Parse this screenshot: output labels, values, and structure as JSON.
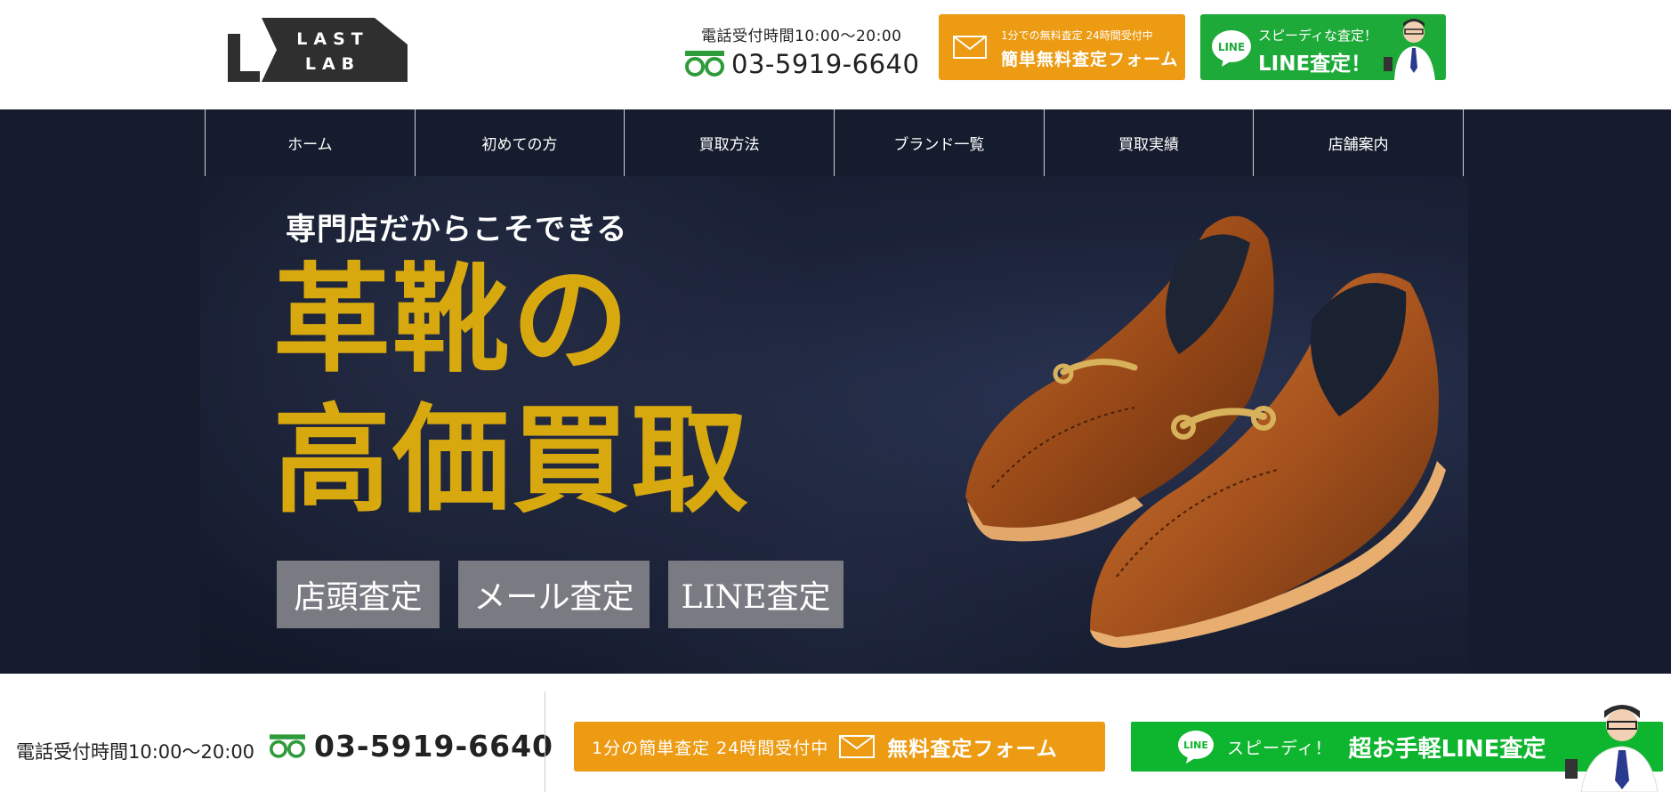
{
  "header": {
    "logo": {
      "line1": "LAST",
      "line2": "LAB",
      "alt": "L LAST LAB"
    },
    "tel": {
      "hours": "電話受付時間10:00〜20:00",
      "number": "03-5919-6640",
      "icon": "free-dial-icon"
    },
    "mail_button": {
      "small": "1分での無料査定 24時間受付中",
      "label": "簡単無料査定フォーム",
      "icon": "mail-icon"
    },
    "line_button": {
      "small": "スピーディな査定！",
      "label": "LINE査定！",
      "icon": "line-icon",
      "icon_text": "LINE"
    }
  },
  "nav": {
    "items": [
      {
        "label": "ホーム"
      },
      {
        "label": "初めての方"
      },
      {
        "label": "買取方法"
      },
      {
        "label": "ブランド一覧"
      },
      {
        "label": "買取実績"
      },
      {
        "label": "店舗案内"
      }
    ]
  },
  "hero": {
    "subtitle": "専門店だからこそできる",
    "title_line1": "革靴の",
    "title_line2": "高価買取",
    "tags": [
      "店頭査定",
      "メール査定",
      "LINE査定"
    ]
  },
  "footer_bar": {
    "hours": "電話受付時間10:00〜20:00",
    "number": "03-5919-6640",
    "mail_button": {
      "small": "1分の簡単査定 24時間受付中",
      "label": "無料査定フォーム"
    },
    "line_button": {
      "small": "スピーディ！",
      "label": "超お手軽LINE査定",
      "icon_text": "LINE"
    }
  },
  "colors": {
    "navy": "#151c2e",
    "orange": "#ec9b12",
    "line_green": "#1eaa39",
    "gold": "#d8a90f",
    "tag_gray": "#7a7b82"
  }
}
